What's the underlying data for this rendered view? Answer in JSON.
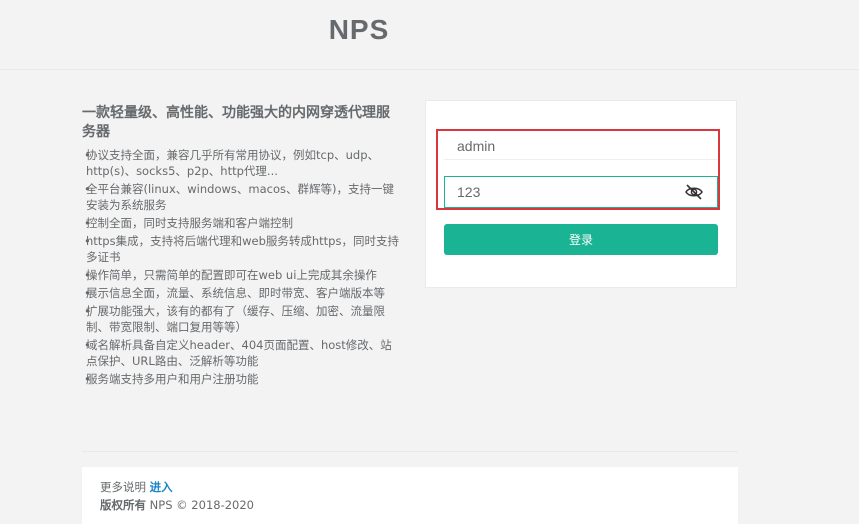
{
  "header": {
    "logo": "NPS"
  },
  "intro": {
    "title": "一款轻量级、高性能、功能强大的内网穿透代理服务器",
    "features": [
      "协议支持全面，兼容几乎所有常用协议，例如tcp、udp、http(s)、socks5、p2p、http代理...",
      "全平台兼容(linux、windows、macos、群辉等)，支持一键安装为系统服务",
      "控制全面，同时支持服务端和客户端控制",
      "https集成，支持将后端代理和web服务转成https，同时支持多证书",
      "操作简单，只需简单的配置即可在web ui上完成其余操作",
      "展示信息全面，流量、系统信息、即时带宽、客户端版本等",
      "扩展功能强大，该有的都有了（缓存、压缩、加密、流量限制、带宽限制、端口复用等等）",
      "域名解析具备自定义header、404页面配置、host修改、站点保护、URL路由、泛解析等功能",
      "服务端支持多用户和用户注册功能"
    ]
  },
  "login": {
    "username_value": "admin",
    "password_value": "123",
    "submit_label": "登录"
  },
  "footer": {
    "more_label": "更多说明",
    "more_link": "进入",
    "copyright_label": "版权所有",
    "copyright_text": "NPS © 2018-2020"
  },
  "colors": {
    "accent": "#1ab394",
    "link": "#1c84c6",
    "highlight_border": "#d9363e"
  },
  "icons": {
    "password_toggle": "eye-off-icon"
  }
}
